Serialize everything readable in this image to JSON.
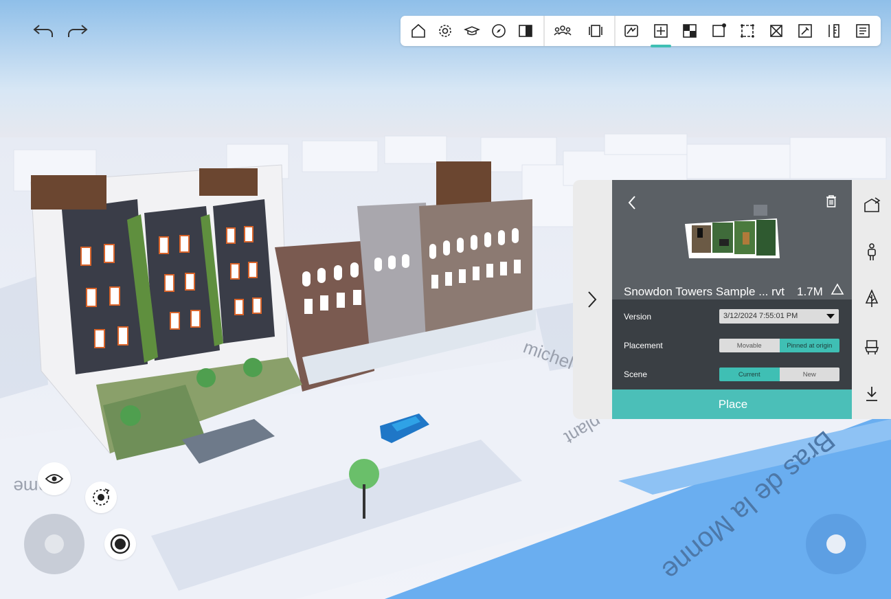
{
  "toolbar": {
    "buttons": [
      {
        "name": "home-icon"
      },
      {
        "name": "settings-gear-icon"
      },
      {
        "name": "graduation-cap-icon"
      },
      {
        "name": "compass-icon"
      },
      {
        "name": "split-view-icon"
      },
      {
        "name": "people-group-icon"
      },
      {
        "name": "section-box-icon"
      },
      {
        "name": "markup-icon"
      },
      {
        "name": "add-model-icon"
      },
      {
        "name": "material-icon"
      },
      {
        "name": "selection-box-icon"
      },
      {
        "name": "crop-icon"
      },
      {
        "name": "hide-element-icon"
      },
      {
        "name": "pin-icon"
      },
      {
        "name": "measure-icon"
      },
      {
        "name": "document-list-icon"
      }
    ],
    "active": "add-model-icon"
  },
  "panel": {
    "model_name": "Snowdon Towers Sample ... rvt",
    "model_size": "1.7M",
    "version_label": "Version",
    "version_value": "3/12/2024 7:55:01 PM",
    "placement_label": "Placement",
    "placement_options": [
      "Movable",
      "Pinned at origin"
    ],
    "placement_selected": "Pinned at origin",
    "scene_label": "Scene",
    "scene_options": [
      "Current",
      "New"
    ],
    "scene_selected": "Current",
    "place_button": "Place"
  },
  "map_labels": {
    "street_1": "michel",
    "street_2": "plant",
    "street_3": "Bras de la Monne",
    "street_4": "ame"
  },
  "colors": {
    "accent": "#3fbfb4",
    "panel_bg": "#5b6065",
    "panel_rows_bg": "#3a3f44",
    "water": "#6aaef0"
  }
}
